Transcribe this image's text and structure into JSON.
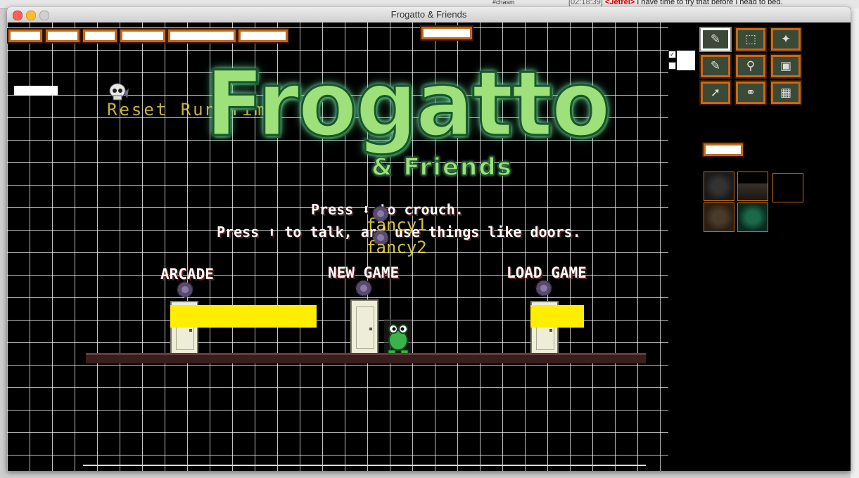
{
  "window": {
    "title": "Frogatto & Friends"
  },
  "background": {
    "irc_time": "[02:18:39]",
    "irc_nick": "<Jetrel>",
    "irc_message": "I have time to try that before I head to bed.",
    "tab_fragment": "#chasm"
  },
  "game": {
    "reset_label": "Reset Run Time",
    "logo": "Frogatto",
    "logo_sub": "& Friends",
    "hint_crouch": "Press ⬇ to crouch.",
    "hint_talk": "Press ⬆ to talk, and use things like doors.",
    "fancy1": "fancy1",
    "fancy2": "fancy2",
    "doors": [
      {
        "label": "ARCADE"
      },
      {
        "label": "NEW GAME"
      },
      {
        "label": "LOAD GAME"
      }
    ]
  },
  "editor": {
    "tools": [
      "pencil-icon",
      "select-rect-icon",
      "magic-wand-icon",
      "pencil-icon",
      "eyedropper-icon",
      "add-object-icon",
      "select-object-icon",
      "group-icon",
      "stack-icon"
    ],
    "tool_glyphs": [
      "✎",
      "⬚",
      "✦",
      "✎",
      "⚲",
      "▣",
      "➚",
      "⚭",
      "▦"
    ]
  },
  "colors": {
    "grid": "#ffffff",
    "editor_frame": "#c56a1a",
    "logo": "#9ee07a",
    "debug_text": "#e6d24a",
    "highlight": "#ffee00"
  }
}
